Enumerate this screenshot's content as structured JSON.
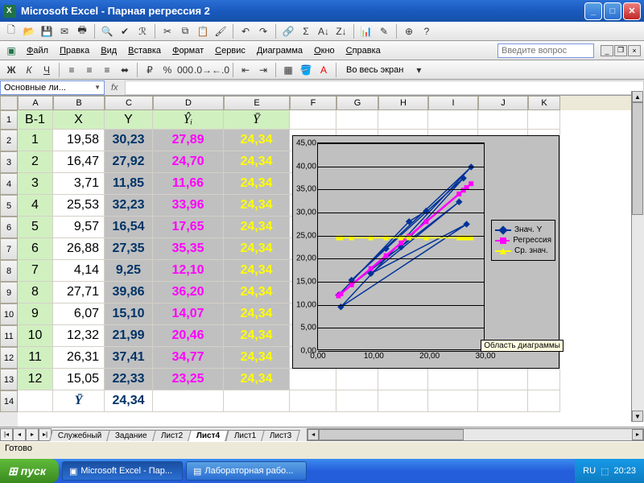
{
  "window": {
    "app_name": "Microsoft Excel",
    "doc_name": "Парная регрессия 2",
    "title": "Microsoft Excel - Парная регрессия 2"
  },
  "menus": [
    "Файл",
    "Правка",
    "Вид",
    "Вставка",
    "Формат",
    "Сервис",
    "Диаграмма",
    "Окно",
    "Справка"
  ],
  "menu_extra": "Во весь экран",
  "ask_placeholder": "Введите вопрос",
  "namebox": "Основные ли...",
  "fx_label": "fx",
  "columns": [
    "A",
    "B",
    "C",
    "D",
    "E",
    "F",
    "G",
    "H",
    "I",
    "J",
    "K"
  ],
  "row_numbers": [
    1,
    2,
    3,
    4,
    5,
    6,
    7,
    8,
    9,
    10,
    11,
    12,
    13,
    14
  ],
  "headers": {
    "A": "В-1",
    "B": "X",
    "C": "Y",
    "D": "Ŷᵢ",
    "E": "Ȳ"
  },
  "data_rows": [
    {
      "n": 1,
      "x": "19,58",
      "y": "30,23",
      "yh": "27,89",
      "yb": "24,34"
    },
    {
      "n": 2,
      "x": "16,47",
      "y": "27,92",
      "yh": "24,70",
      "yb": "24,34"
    },
    {
      "n": 3,
      "x": "3,71",
      "y": "11,85",
      "yh": "11,66",
      "yb": "24,34"
    },
    {
      "n": 4,
      "x": "25,53",
      "y": "32,23",
      "yh": "33,96",
      "yb": "24,34"
    },
    {
      "n": 5,
      "x": "9,57",
      "y": "16,54",
      "yh": "17,65",
      "yb": "24,34"
    },
    {
      "n": 6,
      "x": "26,88",
      "y": "27,35",
      "yh": "35,35",
      "yb": "24,34"
    },
    {
      "n": 7,
      "x": "4,14",
      "y": "9,25",
      "yh": "12,10",
      "yb": "24,34"
    },
    {
      "n": 8,
      "x": "27,71",
      "y": "39,86",
      "yh": "36,20",
      "yb": "24,34"
    },
    {
      "n": 9,
      "x": "6,07",
      "y": "15,10",
      "yh": "14,07",
      "yb": "24,34"
    },
    {
      "n": 10,
      "x": "12,32",
      "y": "21,99",
      "yh": "20,46",
      "yb": "24,34"
    },
    {
      "n": 11,
      "x": "26,31",
      "y": "37,41",
      "yh": "34,77",
      "yb": "24,34"
    },
    {
      "n": 12,
      "x": "15,05",
      "y": "22,33",
      "yh": "23,25",
      "yb": "24,34"
    }
  ],
  "summary_row": {
    "label": "Ȳ",
    "value": "24,34"
  },
  "sheet_tabs": [
    "Служебный",
    "Задание",
    "Лист2",
    "Лист4",
    "Лист1",
    "Лист3"
  ],
  "active_tab": "Лист4",
  "status_text": "Готово",
  "chart_tooltip": "Область диаграммы",
  "taskbar": {
    "start": "пуск",
    "items": [
      "Microsoft Excel - Пар...",
      "Лабораторная рабо..."
    ],
    "lang": "RU",
    "clock": "20:23"
  },
  "chart_data": {
    "type": "line",
    "x_range": [
      0,
      30
    ],
    "y_range": [
      0,
      45
    ],
    "x_ticks": [
      "0,00",
      "10,00",
      "20,00",
      "30,00"
    ],
    "y_ticks": [
      "0,00",
      "5,00",
      "10,00",
      "15,00",
      "20,00",
      "25,00",
      "30,00",
      "35,00",
      "40,00",
      "45,00"
    ],
    "legend": [
      {
        "name": "Знач. Y",
        "color": "#003399",
        "marker": "diamond"
      },
      {
        "name": "Регрессия",
        "color": "#ff00ff",
        "marker": "square"
      },
      {
        "name": "Ср. знач.",
        "color": "#ffff00",
        "marker": "triangle"
      }
    ],
    "series": [
      {
        "name": "Знач. Y",
        "color": "#003399",
        "points": [
          [
            19.58,
            30.23
          ],
          [
            16.47,
            27.92
          ],
          [
            3.71,
            11.85
          ],
          [
            25.53,
            32.23
          ],
          [
            9.57,
            16.54
          ],
          [
            26.88,
            27.35
          ],
          [
            4.14,
            9.25
          ],
          [
            27.71,
            39.86
          ],
          [
            6.07,
            15.1
          ],
          [
            12.32,
            21.99
          ],
          [
            26.31,
            37.41
          ],
          [
            15.05,
            22.33
          ]
        ]
      },
      {
        "name": "Регрессия",
        "color": "#ff00ff",
        "points": [
          [
            19.58,
            27.89
          ],
          [
            16.47,
            24.7
          ],
          [
            3.71,
            11.66
          ],
          [
            25.53,
            33.96
          ],
          [
            9.57,
            17.65
          ],
          [
            26.88,
            35.35
          ],
          [
            4.14,
            12.1
          ],
          [
            27.71,
            36.2
          ],
          [
            6.07,
            14.07
          ],
          [
            12.32,
            20.46
          ],
          [
            26.31,
            34.77
          ],
          [
            15.05,
            23.25
          ]
        ]
      },
      {
        "name": "Ср. знач.",
        "color": "#ffff00",
        "points": [
          [
            19.58,
            24.34
          ],
          [
            16.47,
            24.34
          ],
          [
            3.71,
            24.34
          ],
          [
            25.53,
            24.34
          ],
          [
            9.57,
            24.34
          ],
          [
            26.88,
            24.34
          ],
          [
            4.14,
            24.34
          ],
          [
            27.71,
            24.34
          ],
          [
            6.07,
            24.34
          ],
          [
            12.32,
            24.34
          ],
          [
            26.31,
            24.34
          ],
          [
            15.05,
            24.34
          ]
        ]
      }
    ]
  }
}
